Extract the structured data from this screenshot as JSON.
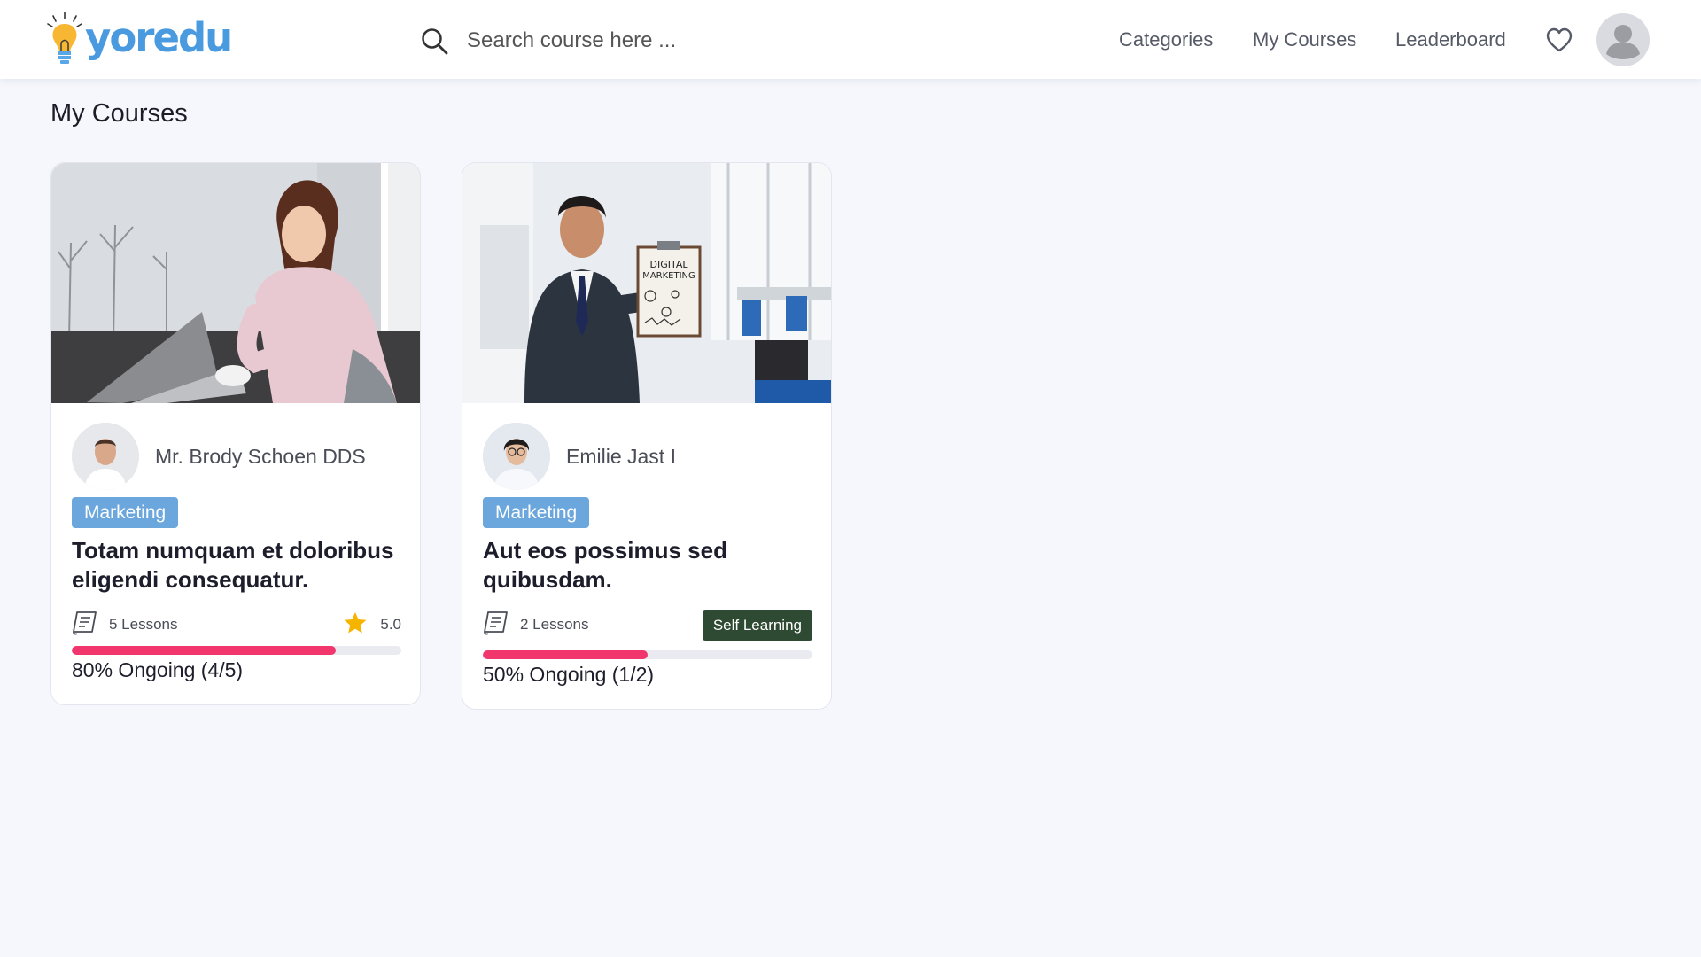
{
  "header": {
    "logo_text": "yoredu",
    "search": {
      "placeholder": "Search course here ..."
    },
    "nav": [
      {
        "label": "Categories"
      },
      {
        "label": "My Courses"
      },
      {
        "label": "Leaderboard"
      }
    ],
    "icons": {
      "search": "search-icon",
      "favorites": "heart-icon",
      "profile": "user-avatar"
    }
  },
  "page": {
    "title": "My Courses"
  },
  "courses": [
    {
      "author": "Mr. Brody Schoen DDS",
      "category": "Marketing",
      "title": "Totam numquam et doloribus eligendi consequatur.",
      "lessons": "5 Lessons",
      "rating": "5.0",
      "progress": 0.8,
      "progress_label": "80% Ongoing (4/5)"
    },
    {
      "author": "Emilie Jast I",
      "category": "Marketing",
      "title": "Aut eos possimus sed quibusdam.",
      "lessons": "2 Lessons",
      "badge": "Self Learning",
      "progress": 0.5,
      "progress_label": "50% Ongoing (1/2)"
    }
  ],
  "colors": {
    "brand": "#4a9ae0",
    "tag": "#6ba7dd",
    "progress": "#f0366c",
    "badge": "#2f4a33",
    "star": "#f5b400",
    "background": "#f5f7fd"
  }
}
